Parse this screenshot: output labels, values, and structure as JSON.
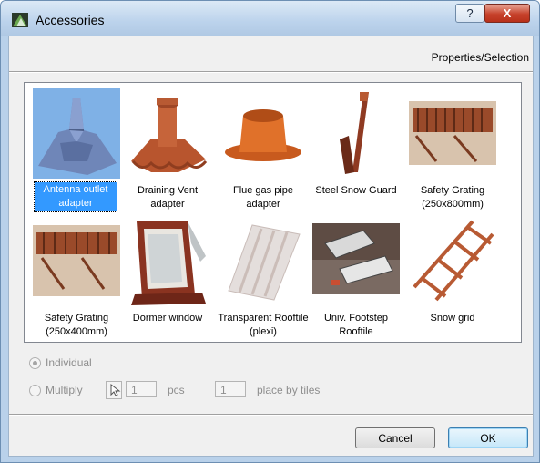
{
  "window": {
    "title": "Accessories"
  },
  "titlebar": {
    "help_label": "?",
    "close_label": "X"
  },
  "header": {
    "properties_label": "Properties/Selection"
  },
  "gallery": {
    "items": [
      {
        "label": "Antenna outlet adapter",
        "selected": true
      },
      {
        "label": "Draining Vent adapter"
      },
      {
        "label": "Flue gas pipe adapter"
      },
      {
        "label": "Steel Snow Guard"
      },
      {
        "label": "Safety Grating (250x800mm)"
      },
      {
        "label": "Safety Grating (250x400mm)"
      },
      {
        "label": "Dormer window"
      },
      {
        "label": "Transparent Rooftile (plexi)"
      },
      {
        "label": "Univ. Footstep Rooftile"
      },
      {
        "label": "Snow grid"
      }
    ]
  },
  "options": {
    "individual_label": "Individual",
    "multiply_label": "Multiply",
    "pcs_value": "1",
    "pcs_label": "pcs",
    "tiles_value": "1",
    "tiles_label": "place by tiles"
  },
  "buttons": {
    "cancel_label": "Cancel",
    "ok_label": "OK"
  }
}
